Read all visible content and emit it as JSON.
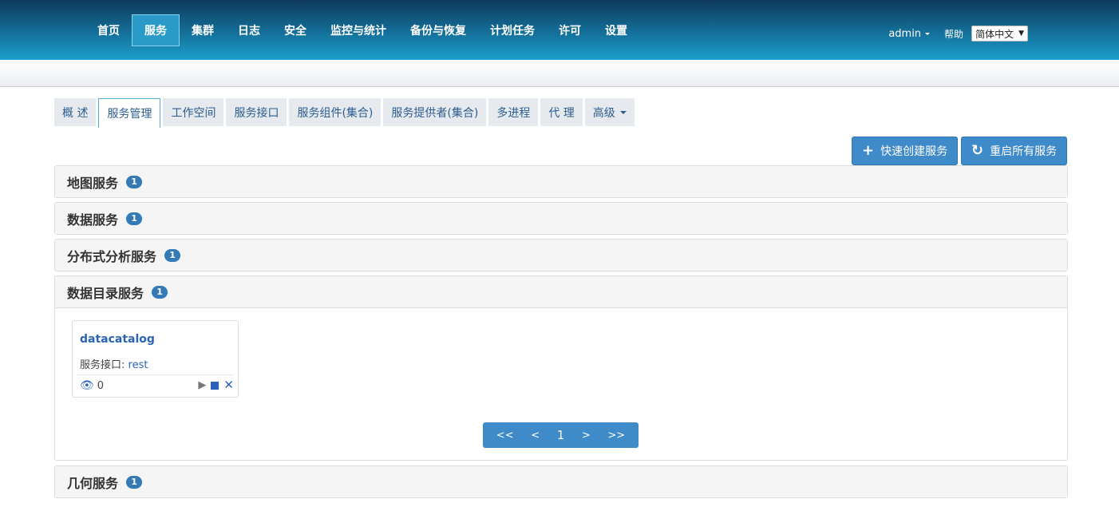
{
  "nav": {
    "items": [
      "首页",
      "服务",
      "集群",
      "日志",
      "安全",
      "监控与统计",
      "备份与恢复",
      "计划任务",
      "许可",
      "设置"
    ],
    "active": "服务",
    "user": "admin",
    "help": "帮助",
    "language": "简体中文"
  },
  "tabs": {
    "items": [
      "概 述",
      "服务管理",
      "工作空间",
      "服务接口",
      "服务组件(集合)",
      "服务提供者(集合)",
      "多进程",
      "代 理",
      "高级"
    ],
    "active": "服务管理"
  },
  "actions": {
    "create": "快速创建服务",
    "restart": "重启所有服务"
  },
  "panels": [
    {
      "title": "地图服务",
      "count": "1"
    },
    {
      "title": "数据服务",
      "count": "1"
    },
    {
      "title": "分布式分析服务",
      "count": "1"
    },
    {
      "title": "数据目录服务",
      "count": "1"
    },
    {
      "title": "几何服务",
      "count": "1"
    }
  ],
  "card": {
    "name": "datacatalog",
    "iface_label": "服务接口:",
    "iface_value": "rest",
    "views": "0"
  },
  "pager": {
    "first": "<<",
    "prev": "<",
    "page": "1",
    "next": ">",
    "last": ">>"
  },
  "colors": {
    "accent": "#3f8ac8",
    "badge": "#337ab7",
    "link": "#2a63b8"
  }
}
